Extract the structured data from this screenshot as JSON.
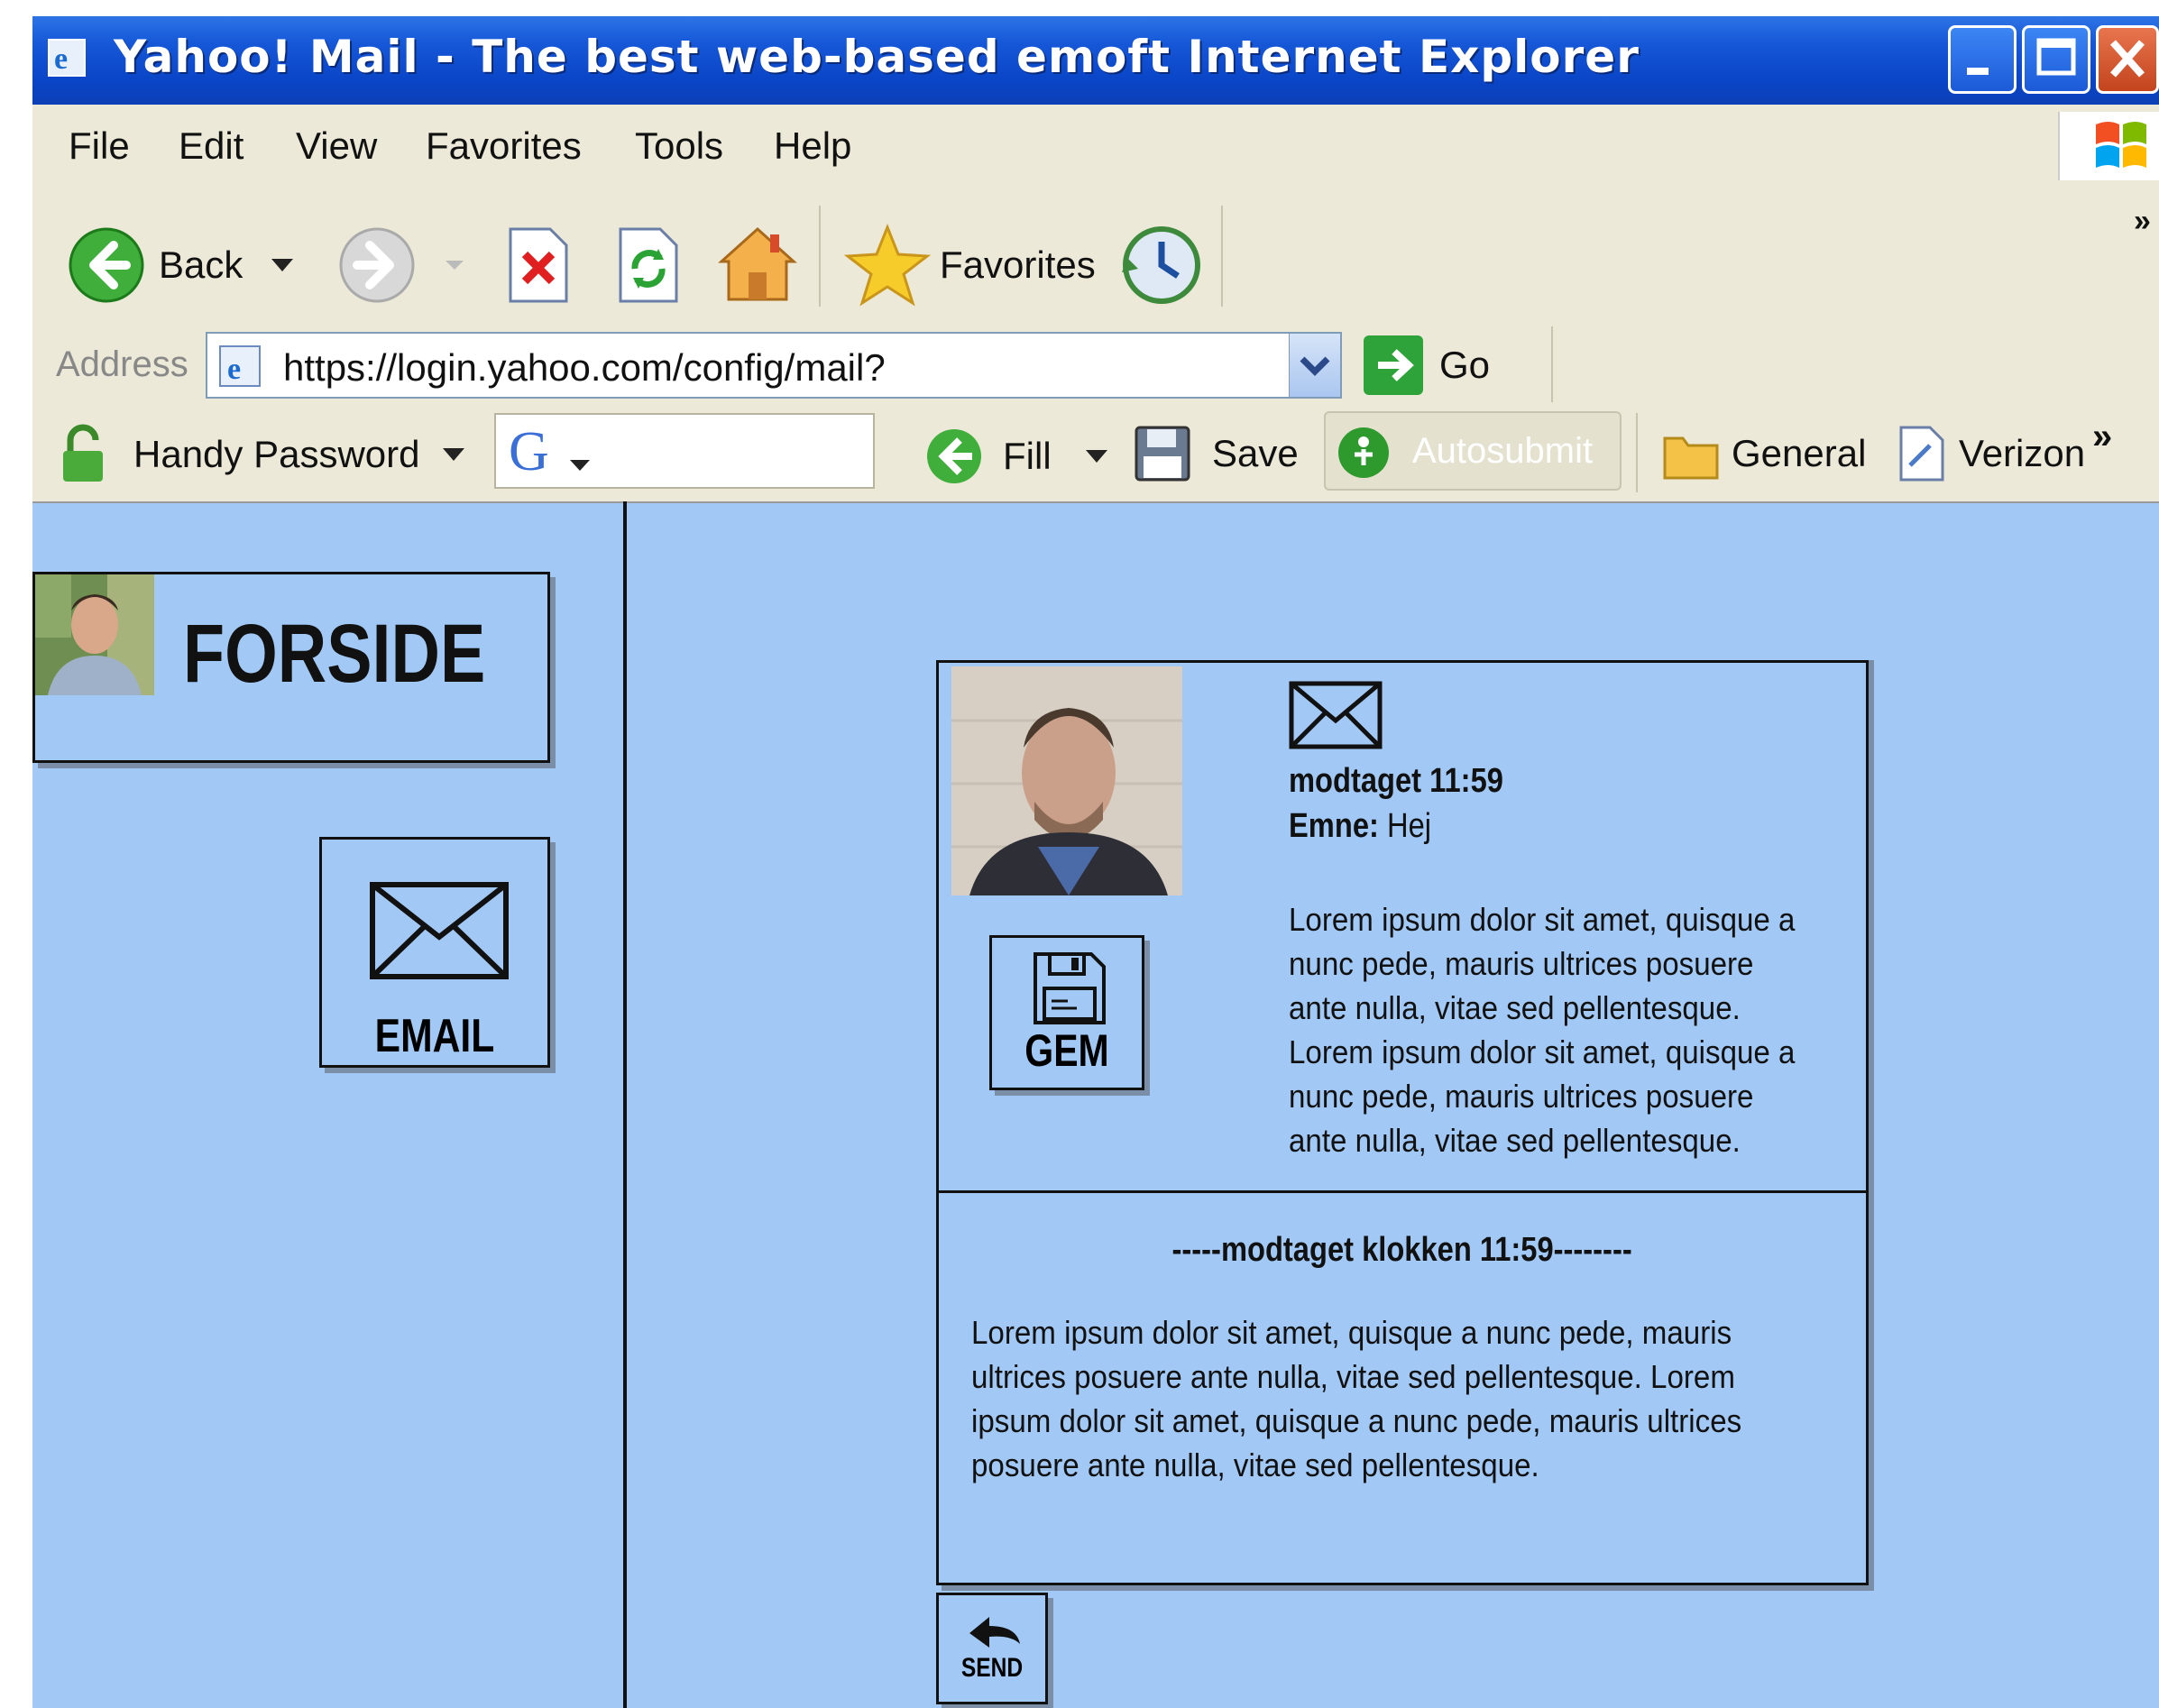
{
  "window": {
    "title": "Yahoo! Mail - The best web-based emoft Internet Explorer"
  },
  "menu": {
    "items": [
      "File",
      "Edit",
      "View",
      "Favorites",
      "Tools",
      "Help"
    ]
  },
  "toolbar": {
    "back_label": "Back",
    "favorites_label": "Favorites",
    "chevron": "»"
  },
  "address": {
    "label": "Address",
    "url": "https://login.yahoo.com/config/mail?",
    "go_label": "Go"
  },
  "links_bar": {
    "handy_password": "Handy Password",
    "google_label": "G",
    "fill_label": "Fill",
    "save_label": "Save",
    "autosubmit_label": "Autosubmit",
    "general_label": "General",
    "verizon_label": "Verizon",
    "more": "»"
  },
  "sidebar": {
    "forside_label": "FORSIDE",
    "email_label": "EMAIL"
  },
  "message": {
    "received": "modtaget 11:59",
    "subject_label": "Emne:",
    "subject_value": "Hej",
    "body": "Lorem ipsum dolor sit amet, quisque a nunc pede, mauris ultrices posuere ante nulla, vitae sed pellentesque.  Lorem ipsum dolor sit amet, quisque a nunc pede, mauris ultrices posuere ante nulla, vitae sed pellentesque.",
    "gem_label": "GEM",
    "reply_header": "-----modtaget klokken 11:59--------",
    "reply_body": "Lorem ipsum dolor sit amet, quisque a nunc pede, mauris ultrices posuere ante nulla, vitae sed pellentesque.  Lorem ipsum dolor sit amet, quisque a nunc pede, mauris ultrices posuere ante nulla, vitae sed pellentesque.",
    "send_label": "SEND"
  },
  "colors": {
    "page_background": "#a2c9f5",
    "titlebar": "#0a46c8",
    "chrome": "#ece9d8"
  }
}
